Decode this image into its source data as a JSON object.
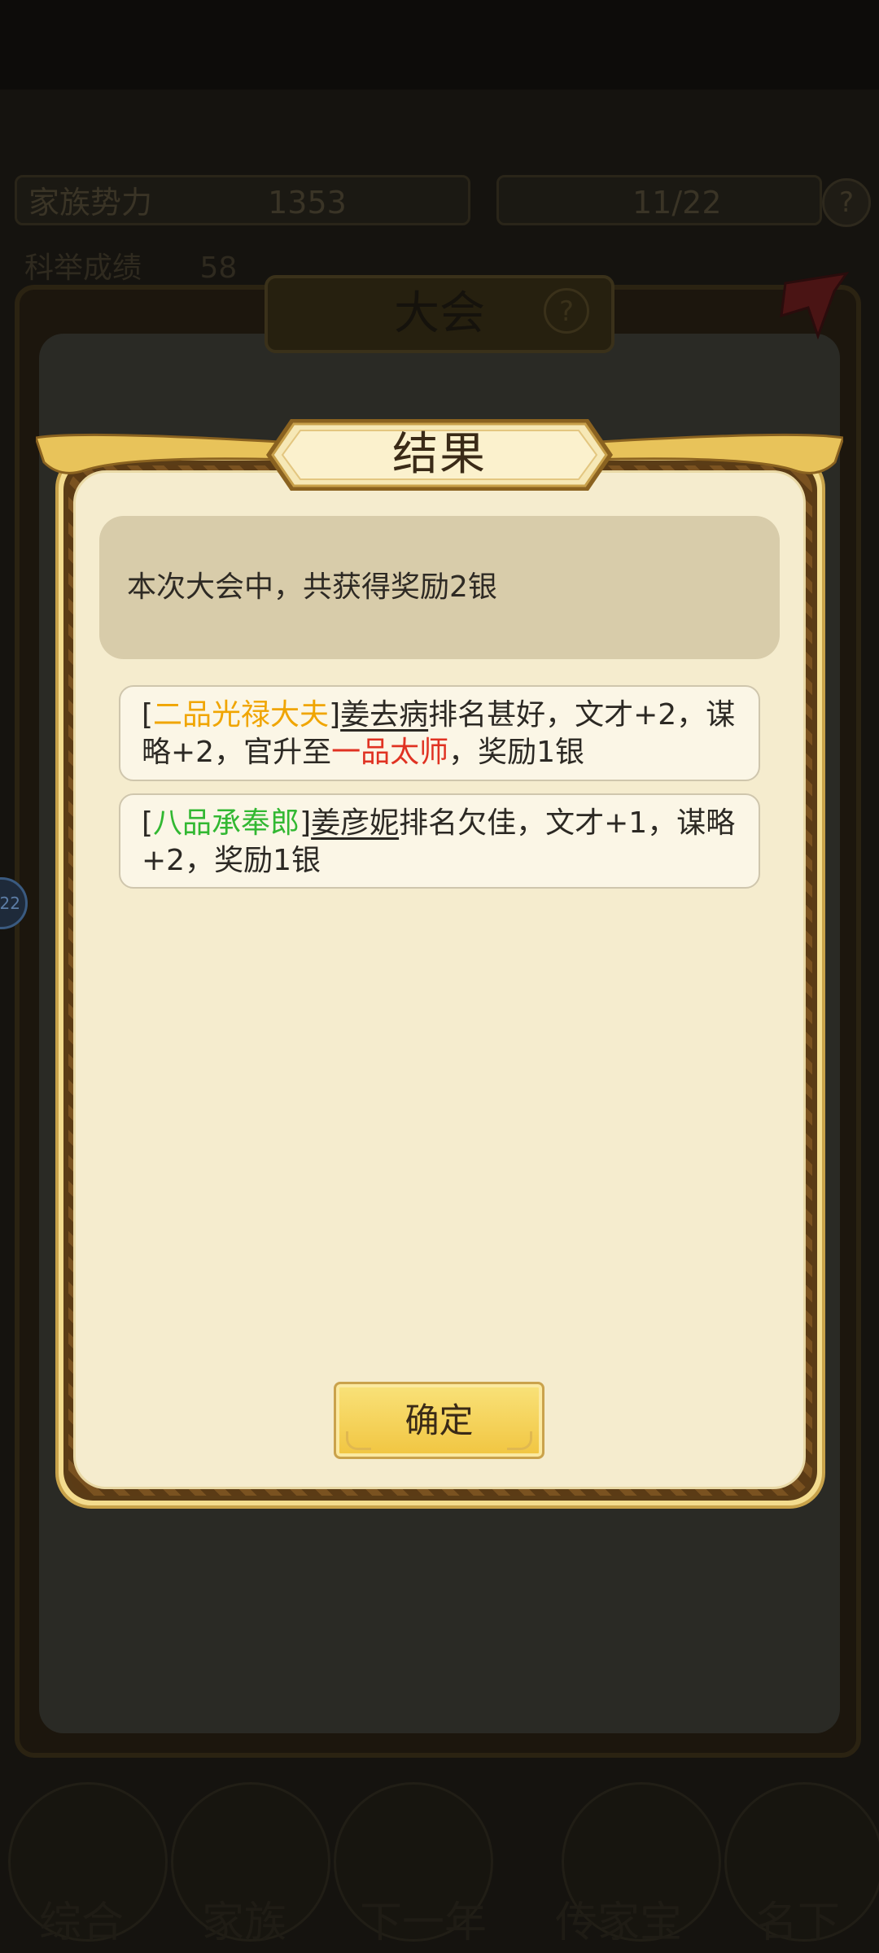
{
  "background": {
    "top_stats": [
      {
        "label": "家族势力",
        "value": "1353"
      },
      {
        "label": "",
        "value": "11/22"
      }
    ],
    "second_row": [
      {
        "label": "科举成绩",
        "value": "58"
      }
    ],
    "panel_title": "大会",
    "panel_help": "?",
    "avatar_label": "22",
    "nav": [
      "综合",
      "家族",
      "下一年",
      "传家宝",
      "名下"
    ]
  },
  "modal": {
    "title": "结果",
    "summary": "本次大会中，共获得奖励2银",
    "results": [
      {
        "open": "[",
        "rank": "二品光禄大夫",
        "close": "]",
        "name": "姜去病",
        "text_a": "排名甚好，文才+2，谋略+2，官升至",
        "promotion": "一品太师",
        "text_b": "，奖励1银"
      },
      {
        "open": "[",
        "rank": "八品承奉郎",
        "close": "]",
        "name": "姜彦妮",
        "text_a": "排名欠佳，文才+1，谋略+2，奖励1银"
      }
    ],
    "confirm_label": "确定"
  },
  "colors": {
    "rank_gold": "#f0a500",
    "rank_green": "#32b832",
    "promotion_red": "#e03222",
    "paper": "#f5ecce",
    "button": "#f1c540"
  }
}
